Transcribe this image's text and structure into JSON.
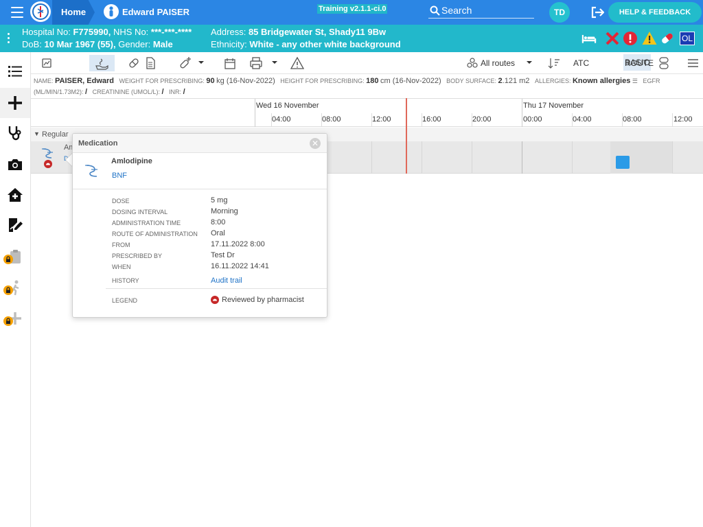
{
  "topbar": {
    "home_label": "Home",
    "patient_name": "Edward PAISER",
    "training_label": "Training v2.1.1-ci.0",
    "search_label": "Search",
    "avatar_initials": "TD",
    "help_label": "HELP & FEEDBACK"
  },
  "banner": {
    "hospital_label": "Hospital No:",
    "hospital_no": "F775990,",
    "nhs_label": "NHS No:",
    "nhs_no": "***-***-****",
    "dob_label": "DoB:",
    "dob": "10 Mar 1967 (55),",
    "gender_label": "Gender:",
    "gender": "Male",
    "address_label": "Address:",
    "address": "85 Bridgewater St, Shady11 9Bw",
    "ethnicity_label": "Ethnicity:",
    "ethnicity": "White - any other white background",
    "ol_badge": "OL",
    "colors": {
      "red": "#e32636",
      "warning": "#f5c518"
    }
  },
  "toolbar": {
    "routes_label": "All routes",
    "atc_label": "ATC",
    "basic_label": "BASIC",
    "route_label": "ROUTE"
  },
  "info": {
    "name_label": "NAME:",
    "name": "PAISER, Edward",
    "weight_label": "WEIGHT FOR PRESCRIBING:",
    "weight": "90",
    "weight_unit": "kg (16-Nov-2022)",
    "height_label": "HEIGHT FOR PRESCRIBING:",
    "height": "180",
    "height_unit": "cm (16-Nov-2022)",
    "bsa_label": "BODY SURFACE:",
    "bsa_int": "2",
    "bsa_dec": ".121 m2",
    "allergies_label": "ALLERGIES:",
    "allergies": "Known allergies",
    "egfr_label": "EGFR",
    "egfr_unit": "(ML/MIN/1.73M2):",
    "egfr": "/",
    "creat_label": "CREATININE (UMOL/L):",
    "creat": "/",
    "inr_label": "INR:",
    "inr": "/"
  },
  "timeline": {
    "day1": "Wed 16 November",
    "day2": "Thu 17 November",
    "ticks": [
      "04:00",
      "08:00",
      "12:00",
      "16:00",
      "20:00",
      "00:00",
      "04:00",
      "08:00",
      "12:00"
    ]
  },
  "regular_label": "Regular",
  "med_row": {
    "name_stub": "Am",
    "sub_stub": "D"
  },
  "popup": {
    "title": "Medication",
    "drug": "Amlodipine",
    "bnf": "BNF",
    "rows": [
      {
        "label": "DOSE",
        "value": "5 mg"
      },
      {
        "label": "DOSING INTERVAL",
        "value": "Morning"
      },
      {
        "label": "ADMINISTRATION TIME",
        "value": "8:00"
      },
      {
        "label": "ROUTE OF ADMINISTRATION",
        "value": "Oral"
      },
      {
        "label": "FROM",
        "value": "17.11.2022 8:00"
      },
      {
        "label": "PRESCRIBED BY",
        "value": "Test Dr"
      },
      {
        "label": "WHEN",
        "value": "16.11.2022 14:41"
      }
    ],
    "history_label": "HISTORY",
    "history_value": "Audit trail",
    "legend_label": "LEGEND",
    "legend_value": "Reviewed by pharmacist"
  }
}
